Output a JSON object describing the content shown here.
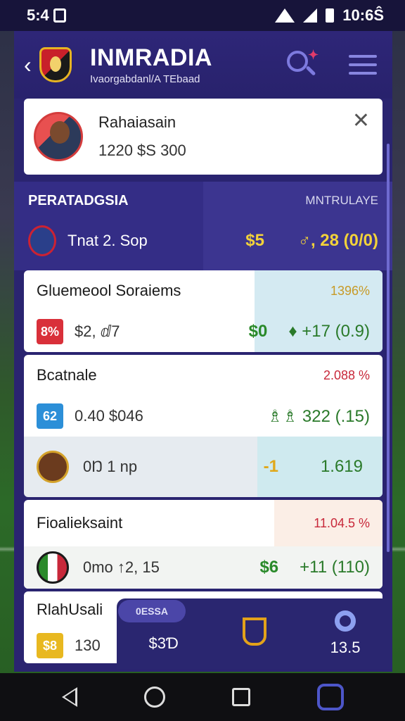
{
  "status": {
    "left_time": "5:4",
    "right_time": "10:6Ŝ"
  },
  "header": {
    "title": "INMRADIA",
    "subtitle": "Ivaorgabdanl/A TEbaad"
  },
  "profile": {
    "name": "Rahaiasain",
    "balance": "1220 $S 300"
  },
  "market": {
    "title": "PERATADGSIA",
    "right_label": "MNTRULAYE",
    "row_text": "Tnat 2. Sop",
    "value1": "$5",
    "value2": "♂, 28 (0/0)"
  },
  "items": [
    {
      "title": "Gluemeool Soraiems",
      "pct": "1396%",
      "pct_color": "#c79a26",
      "badge": "8%",
      "badge_color": "#d9303a",
      "text": "$2, ⅆ7",
      "value": "$0",
      "odds": "♦ +17 (0.9)",
      "tint": "#d4eaf2"
    },
    {
      "title": "Bcatnale",
      "pct": "2.088 %",
      "pct_color": "#c8283a",
      "badge": "62",
      "badge_color": "#2c8fd8",
      "text": "0.40 $046",
      "value": "",
      "odds": "♗♗ 322 (.15)",
      "tint": "#ffffff"
    },
    {
      "title": "",
      "pct": "",
      "pct_color": "#000000",
      "badge": "",
      "badge_color": "#ffffff",
      "text": "0Ŋ 1 np",
      "value": "-1",
      "odds": "1.619",
      "tint": "#cfeaef"
    },
    {
      "title": "Fioalieksaint",
      "pct": "11.04.5 %",
      "pct_color": "#c8283a",
      "badge": "",
      "badge_color": "#ffffff",
      "text": "0mo ↑2, 15",
      "value": "$6",
      "odds": "+11 (110)",
      "tint": "#d6ecd6"
    },
    {
      "title": "RlahUsali",
      "pct": "",
      "pct_color": "#000000",
      "badge": "$8",
      "badge_color": "#e8b820",
      "text": "130",
      "value": "",
      "odds": "",
      "tint": "#ffffff"
    }
  ],
  "bottom_nav": {
    "pill": "0ESSA",
    "left": "$3Ɗ",
    "right": "13.5"
  }
}
